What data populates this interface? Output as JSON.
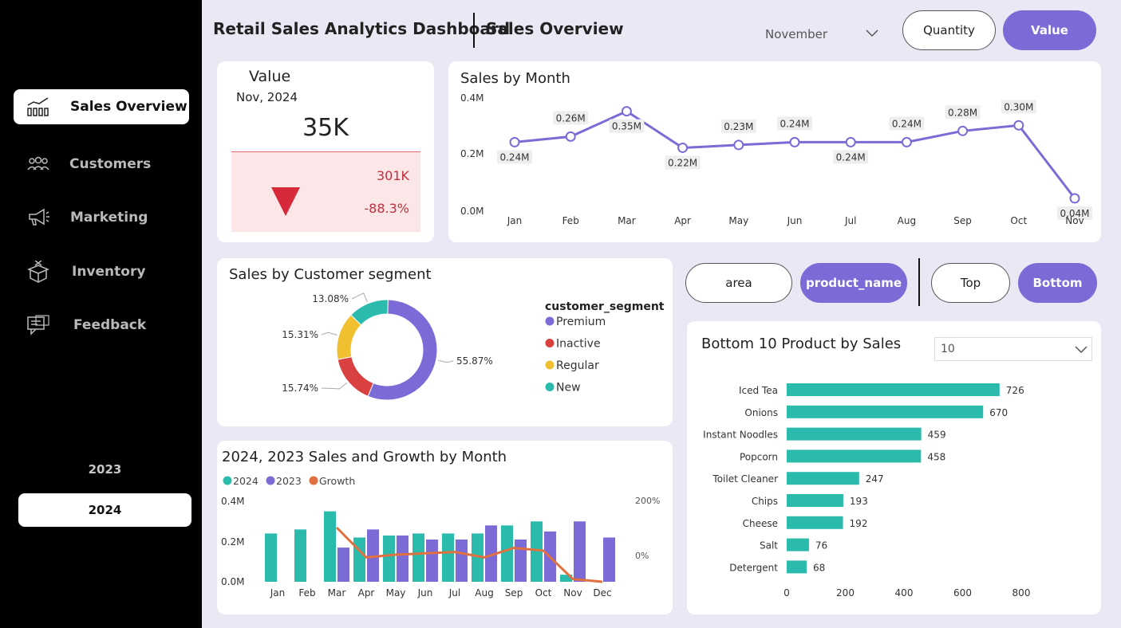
{
  "header": {
    "title": "Retail Sales Analytics Dashboard",
    "subtitle": "Sales Overview",
    "month_select": "November",
    "toggle_quantity": "Quantity",
    "toggle_value": "Value"
  },
  "sidebar": {
    "items": [
      {
        "label": "Sales Overview"
      },
      {
        "label": "Customers"
      },
      {
        "label": "Marketing"
      },
      {
        "label": "Inventory"
      },
      {
        "label": "Feedback"
      }
    ],
    "years": [
      "2023",
      "2024"
    ]
  },
  "kpi": {
    "title": "Value",
    "period": "Nov, 2024",
    "value": "35K",
    "compare": "301K",
    "change": "-88.3%"
  },
  "filters": {
    "area": "area",
    "product_name": "product_name",
    "top": "Top",
    "bottom": "Bottom",
    "count": "10"
  },
  "chart_data": [
    {
      "type": "line",
      "title": "Sales by Month",
      "categories": [
        "Jan",
        "Feb",
        "Mar",
        "Apr",
        "May",
        "Jun",
        "Jul",
        "Aug",
        "Sep",
        "Oct",
        "Nov"
      ],
      "values": [
        0.24,
        0.26,
        0.35,
        0.22,
        0.23,
        0.24,
        0.24,
        0.24,
        0.28,
        0.3,
        0.04
      ],
      "labels": [
        "0.24M",
        "0.26M",
        "0.35M",
        "0.22M",
        "0.23M",
        "0.24M",
        "0.24M",
        "0.24M",
        "0.28M",
        "0.30M",
        "0.04M"
      ],
      "yticks": [
        "0.4M",
        "0.2M",
        "0.0M"
      ],
      "ylim": [
        0,
        0.4
      ],
      "color": "#7b6bd6"
    },
    {
      "type": "pie",
      "title": "Sales by Customer segment",
      "legend_title": "customer_segment",
      "categories": [
        "Premium",
        "Inactive",
        "Regular",
        "New"
      ],
      "values": [
        55.87,
        15.74,
        15.31,
        13.08
      ],
      "labels": [
        "55.87%",
        "15.74%",
        "15.31%",
        "13.08%"
      ],
      "colors": [
        "#7b6bd6",
        "#d94040",
        "#f0c030",
        "#2bbbad"
      ]
    },
    {
      "type": "bar",
      "title": "2024, 2023 Sales and Growth by Month",
      "categories": [
        "Jan",
        "Feb",
        "Mar",
        "Apr",
        "May",
        "Jun",
        "Jul",
        "Aug",
        "Sep",
        "Oct",
        "Nov",
        "Dec"
      ],
      "series": [
        {
          "name": "2024",
          "values": [
            0.24,
            0.26,
            0.35,
            0.22,
            0.23,
            0.24,
            0.24,
            0.24,
            0.28,
            0.3,
            0.035,
            null
          ],
          "color": "#2bbbad"
        },
        {
          "name": "2023",
          "values": [
            null,
            null,
            0.17,
            0.26,
            0.23,
            0.21,
            0.21,
            0.28,
            0.21,
            0.25,
            0.3,
            0.22
          ],
          "color": "#7b6bd6"
        },
        {
          "name": "Growth",
          "values": [
            null,
            null,
            100,
            -10,
            0,
            5,
            10,
            -10,
            25,
            15,
            -90,
            -100
          ],
          "color": "#e07040"
        }
      ],
      "yticks": [
        "0.4M",
        "0.2M",
        "0.0M"
      ],
      "y2ticks": [
        "200%",
        "0%"
      ],
      "ylim": [
        0,
        0.4
      ],
      "y2lim": [
        -100,
        200
      ]
    },
    {
      "type": "bar",
      "title": "Bottom 10 Product by Sales",
      "categories": [
        "Iced Tea",
        "Onions",
        "Instant Noodles",
        "Popcorn",
        "Toilet Cleaner",
        "Chips",
        "Cheese",
        "Salt",
        "Detergent"
      ],
      "values": [
        726,
        670,
        459,
        458,
        247,
        193,
        192,
        76,
        68
      ],
      "xticks": [
        "0",
        "200",
        "400",
        "600",
        "800"
      ],
      "xlim": [
        0,
        800
      ],
      "color": "#2bbbad"
    }
  ]
}
